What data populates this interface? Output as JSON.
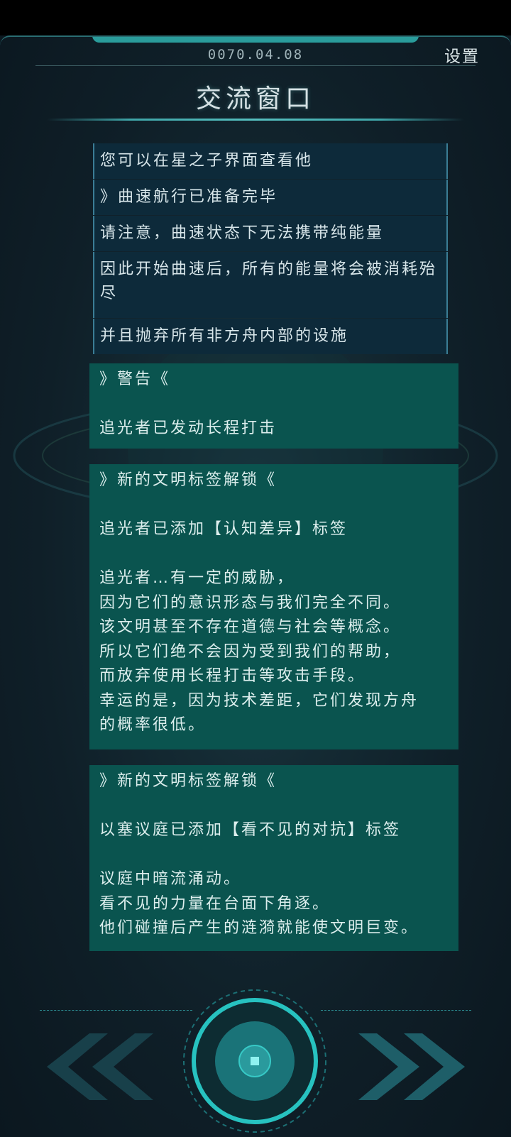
{
  "header": {
    "date": "0070.04.08",
    "settings_label": "设置",
    "title": "交流窗口"
  },
  "messages": [
    {
      "text": "您可以在星之子界面查看他"
    },
    {
      "text": "》曲速航行已准备完毕"
    },
    {
      "text": "请注意，曲速状态下无法携带纯能量"
    },
    {
      "text": "因此开始曲速后，所有的能量将会被消耗殆尽"
    },
    {
      "text": "并且抛弃所有非方舟内部的设施"
    }
  ],
  "cards": [
    {
      "lines": [
        "》警告《",
        "",
        "追光者已发动长程打击"
      ]
    },
    {
      "lines": [
        "》新的文明标签解锁《",
        "",
        "追光者已添加【认知差异】标签",
        "",
        "追光者…有一定的威胁，",
        "因为它们的意识形态与我们完全不同。",
        "该文明甚至不存在道德与社会等概念。",
        "所以它们绝不会因为受到我们的帮助，",
        "而放弃使用长程打击等攻击手段。",
        "幸运的是，因为技术差距，它们发现方舟",
        "的概率很低。"
      ]
    },
    {
      "lines": [
        "》新的文明标签解锁《",
        "",
        "以塞议庭已添加【看不见的对抗】标签",
        "",
        "议庭中暗流涌动。",
        "看不见的力量在台面下角逐。",
        "他们碰撞后产生的涟漪就能使文明巨变。"
      ]
    }
  ],
  "controls": {
    "prev_icon": "double-chevron-left-icon",
    "center_icon": "target-button-icon",
    "next_icon": "double-chevron-right-icon"
  },
  "colors": {
    "accent": "#2fb3b0",
    "card_bg": "#0a544f",
    "message_bg": "#0d2a3a"
  }
}
